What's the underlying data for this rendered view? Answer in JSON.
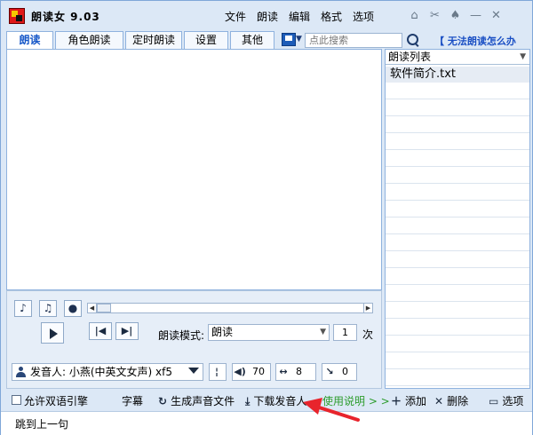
{
  "app": {
    "title": "朗读女 9.03",
    "menu": [
      "文件",
      "朗读",
      "编辑",
      "格式",
      "选项"
    ],
    "window_icons": [
      "home-icon",
      "tools-icon",
      "shirt-icon",
      "minimize-icon",
      "close-icon"
    ]
  },
  "tabs": [
    {
      "label": "朗读",
      "active": true
    },
    {
      "label": "角色朗读",
      "active": false
    },
    {
      "label": "定时朗读",
      "active": false
    },
    {
      "label": "设置",
      "active": false
    },
    {
      "label": "其他",
      "active": false
    }
  ],
  "search": {
    "placeholder": "点此搜索",
    "help_link": "【 无法朗读怎么办"
  },
  "playlist": {
    "header": "朗读列表",
    "items": [
      "软件简介.txt"
    ]
  },
  "player": {
    "mode_label": "朗读模式:",
    "mode_value": "朗读",
    "repeat_count": "1",
    "repeat_unit": "次",
    "voice_label": "发音人: 小燕(中英文女声) xf5",
    "volume": "70",
    "speed": "8",
    "pitch": "0"
  },
  "bottombar": {
    "bilingual_label": "允许双语引擎",
    "subtitle": "字幕",
    "generate_audio": "生成声音文件",
    "download_voice": "下载发音人",
    "usage": "使用说明 > >",
    "add": "添加",
    "delete": "删除",
    "options": "选项"
  },
  "status": {
    "text": "跳到上一句"
  },
  "colors": {
    "accent_blue": "#1758c8",
    "annotation_red": "#e8242c",
    "usage_green": "#2c9c2c"
  }
}
